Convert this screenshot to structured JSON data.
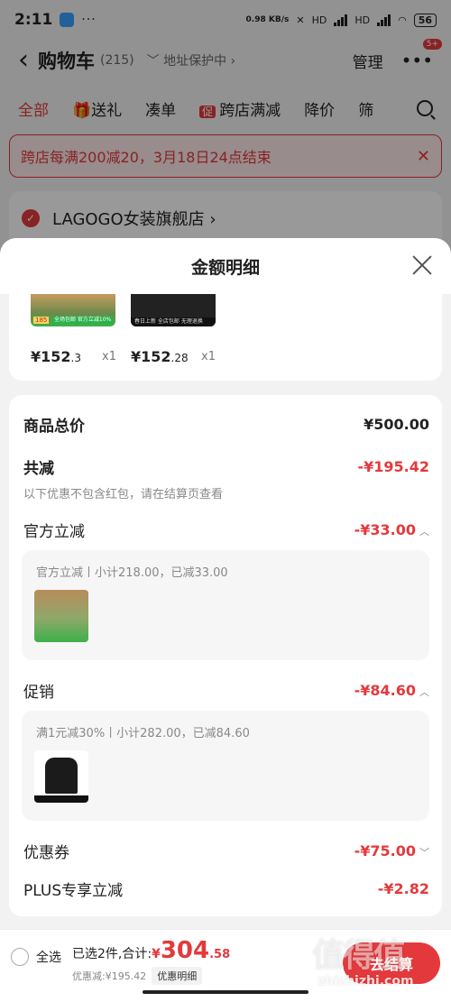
{
  "status_bar": {
    "time": "2:11",
    "dots": "···",
    "speed": "0.98 KB/s",
    "signal1": "HD",
    "signal2": "HD",
    "battery": "56"
  },
  "header": {
    "title": "购物车",
    "count": "(215)",
    "address": "﹀ 地址保护中 ›",
    "manage": "管理",
    "badge": "5+"
  },
  "tabs": [
    {
      "label": "全部"
    },
    {
      "label": "送礼"
    },
    {
      "label": "凑单"
    },
    {
      "label": "跨店满减",
      "badge": "促"
    },
    {
      "label": "降价"
    },
    {
      "label": "筛"
    }
  ],
  "promo": {
    "text": "跨店每满200减20，3月18日24点结束"
  },
  "shop": {
    "name": "LAGOGO女装旗舰店 ›"
  },
  "sheet": {
    "title": "金额明细",
    "products": [
      {
        "price_int": "¥152",
        "price_dec": ".3",
        "qty": "x1",
        "tag": "185",
        "strip": "全场包邮 官方立减10%"
      },
      {
        "price_int": "¥152",
        "price_dec": ".28",
        "qty": "x1",
        "strip": "春日上新 全店包邮 无理退换"
      }
    ],
    "total": {
      "label": "商品总价",
      "value": "¥500.00"
    },
    "reduction": {
      "label": "共减",
      "value": "-¥195.42",
      "note": "以下优惠不包含红包，请在结算页查看"
    },
    "official": {
      "label": "官方立减",
      "value": "-¥33.00",
      "line": "官方立减丨小计218.00，已减33.00"
    },
    "promotion": {
      "label": "促销",
      "value": "-¥84.60",
      "line": "满1元减30%丨小计282.00，已减84.60"
    },
    "coupon": {
      "label": "优惠券",
      "value": "-¥75.00"
    },
    "plus": {
      "label": "PLUS专享立减",
      "value": "-¥2.82"
    }
  },
  "bottom": {
    "select_all": "全选",
    "selected": "已选2件,合计:",
    "currency": "¥",
    "total_int": "304",
    "total_dec": ".58",
    "discount": "优惠减:¥195.42",
    "detail_btn": "优惠明细",
    "checkout": "去结算"
  },
  "watermark": {
    "text": "值得值",
    "url": "zhizhizhi.com"
  },
  "colors": {
    "accent": "#e4393c"
  }
}
